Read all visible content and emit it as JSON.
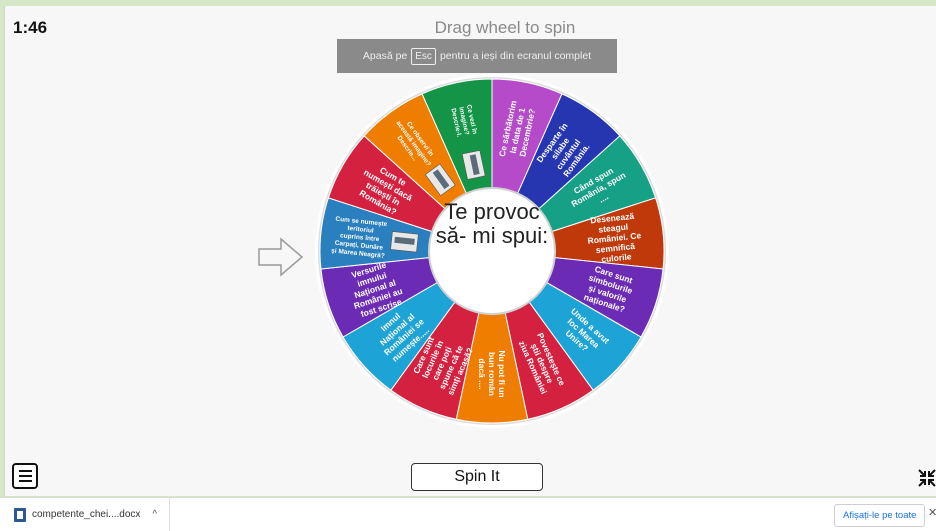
{
  "timer": "1:46",
  "drag_hint": "Drag wheel to spin",
  "fullscreen_banner": {
    "prefix": "Apasă pe",
    "key": "Esc",
    "suffix": "pentru a ieși din ecranul complet"
  },
  "wheel": {
    "center_text": "Te provoc să- mi spui:",
    "segments": [
      {
        "text": "Ce sărbătorim la data de 1 Decembrie?",
        "color": "#b54bc9"
      },
      {
        "text": "Desparte în silabe cuvântul România.",
        "color": "#2536b0"
      },
      {
        "text": "Când spun Românía, spun ....",
        "color": "#16a085"
      },
      {
        "text": "Desenează steagul României. Ce semnifică culorile drapelului?",
        "color": "#c0390b"
      },
      {
        "text": "Care sunt simbolurile și valorile naționale?",
        "color": "#6c2bb5"
      },
      {
        "text": "Unde a avut loc Marea Unire?",
        "color": "#1ea3d6"
      },
      {
        "text": "Povestește ce știi despre ziua României",
        "color": "#d3213f"
      },
      {
        "text": "Nu pot fi un bun român dacă ....",
        "color": "#ef7d00"
      },
      {
        "text": "Care sunt locurile în care poți spune că te simți acasă?",
        "color": "#d3213f"
      },
      {
        "text": "Imnul Național al României se numește.....",
        "color": "#1ea3d6"
      },
      {
        "text": "Versurile imnului Național al României au fost scrise de.... iar muzica a fost compusă de ....",
        "color": "#6c2bb5"
      },
      {
        "text": "Cum se numește teritoriul cuprins între Carpați, Dunăre și Marea Neagră?",
        "color": "#2a7fbf",
        "image": true
      },
      {
        "text": "Cum te numești dacă trăiești în România?",
        "color": "#d3213f"
      },
      {
        "text": "Ce observi în această imagine? Descrie...",
        "color": "#ef7d00",
        "image": true
      },
      {
        "text": "Ce vezi în imagine? Descrie-l.",
        "color": "#139447",
        "image": true
      }
    ]
  },
  "buttons": {
    "spin": "Spin It"
  },
  "icons": {
    "menu": "hamburger-menu-icon",
    "pointer": "arrow-right-icon",
    "exit_fullscreen": "exit-fullscreen-icon",
    "file": "word-document-icon"
  },
  "download_bar": {
    "file_name": "competente_chei....docx",
    "show_all": "Afișați-le pe toate",
    "close": "✕"
  }
}
